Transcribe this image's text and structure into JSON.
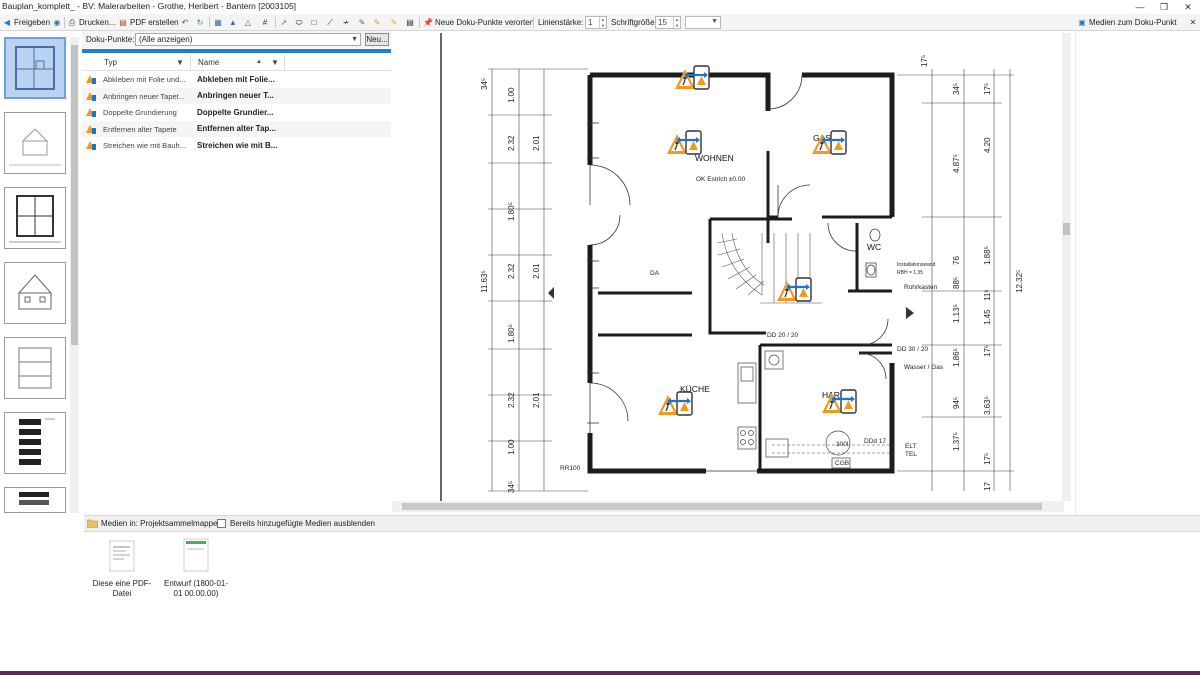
{
  "window": {
    "title": "Bauplan_komplett_ - BV: Malerarbeiten - Grothe, Heribert - Bantern [2003105]",
    "controls": [
      "minimize-icon",
      "restore-icon",
      "close-icon"
    ]
  },
  "toolbar": {
    "share_label": "Freigeben",
    "print_label": "Drucken...",
    "pdf_label": "PDF erstellen",
    "locate_label": "Neue Doku-Punkte verorten",
    "line_width_label": "Linienstärke:",
    "line_width_value": "1",
    "font_size_label": "Schriftgröße:",
    "font_size_value": "15",
    "media_to_point_label": "Medien zum Doku-Punkt"
  },
  "doku": {
    "filter_label": "Doku-Punkte:",
    "filter_value": "(Alle anzeigen)",
    "new_button": "Neu...",
    "columns": {
      "typ": "Typ",
      "name": "Name"
    },
    "rows": [
      {
        "typ": "Abkleben mit Folie und...",
        "name": "Abkleben mit Folie..."
      },
      {
        "typ": "Anbringen neuer Tapet...",
        "name": "Anbringen neuer T..."
      },
      {
        "typ": "Doppelte Grundierung",
        "name": "Doppelte Grundier..."
      },
      {
        "typ": "Entfernen alter Tapete",
        "name": "Entfernen alter Tap..."
      },
      {
        "typ": "Streichen wie mit Bauh...",
        "name": "Streichen wie mit B..."
      }
    ]
  },
  "plan": {
    "rooms": [
      "WOHNEN",
      "GAST",
      "WC",
      "KÜCHE",
      "HAR"
    ],
    "annotations": [
      "OK Estrich ±0.00",
      "DD 20 / 20",
      "DD 30 / 20",
      "Wasser / Gas",
      "Rohrkasten",
      "Installationswand",
      "RBH = 1.35",
      "ELT",
      "TEL",
      "DA",
      "RR100",
      "DDd 17",
      "300l",
      "CGB"
    ],
    "dims_left": [
      "34⁵",
      "1.00",
      "2.01",
      "2.32",
      "1.80⁵",
      "2.01",
      "2.32",
      "1.80⁵",
      "2.01",
      "2.32",
      "1.00",
      "34⁵"
    ],
    "total_left": "11.63⁵",
    "total_right": "12.32⁵",
    "dims_right": [
      "17⁵",
      "34⁵",
      "4.87⁵",
      "4.20",
      "17⁵",
      "1.88⁵",
      "76",
      "88⁵",
      "1.13⁵",
      "1.45",
      "11⁵",
      "17⁵",
      "1.86⁵",
      "94⁵",
      "3.63⁵",
      "1.37⁵",
      "17⁵",
      "17"
    ]
  },
  "media": {
    "folder_label": "Medien in: Projektsammelmappe",
    "hide_label": "Bereits hinzugefügte Medien ausblenden",
    "items": [
      {
        "label": "Diese eine PDF-Datei"
      },
      {
        "label": "Entwurf (1800-01-01 00.00.00)"
      }
    ]
  },
  "colors": {
    "accent": "#1e7fd2",
    "marker_orange": "#f39a1e",
    "marker_blue": "#1b75d0",
    "wall": "#1c1c1c",
    "taskbar": "#5b2a52"
  }
}
